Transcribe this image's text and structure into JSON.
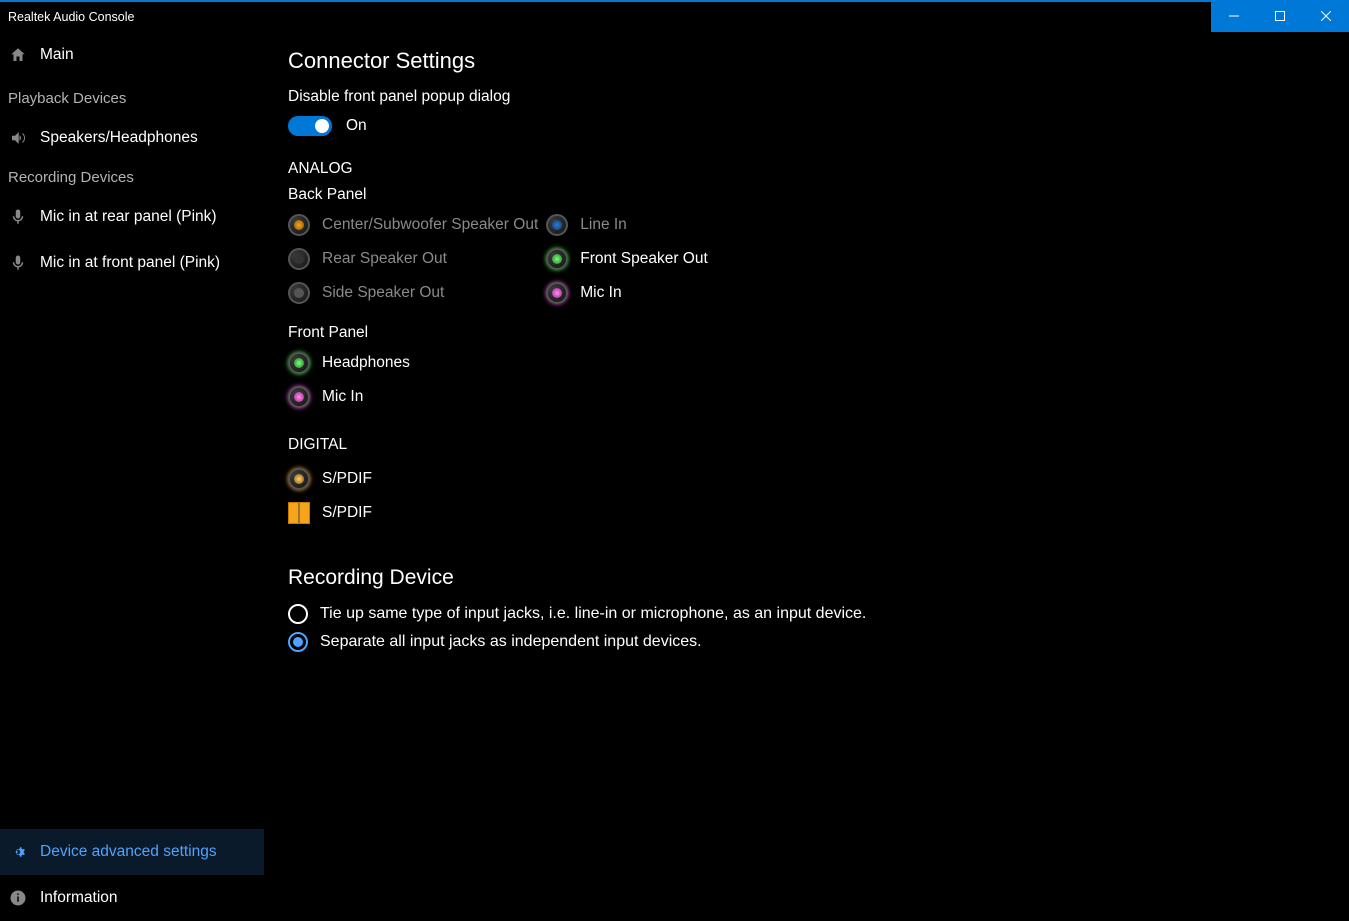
{
  "titlebar": {
    "title": "Realtek Audio Console"
  },
  "sidebar": {
    "main": "Main",
    "playback_group": "Playback Devices",
    "speakers": "Speakers/Headphones",
    "recording_group": "Recording Devices",
    "mic_rear": "Mic in at rear panel (Pink)",
    "mic_front": "Mic in at front panel (Pink)",
    "advanced": "Device advanced settings",
    "information": "Information"
  },
  "content": {
    "heading": "Connector Settings",
    "disable_popup_label": "Disable front panel popup dialog",
    "toggle_state": "On",
    "analog_head": "ANALOG",
    "back_panel": "Back Panel",
    "jacks_back_left": {
      "center_sub": "Center/Subwoofer Speaker Out",
      "rear": "Rear Speaker Out",
      "side": "Side Speaker Out"
    },
    "jacks_back_right": {
      "line_in": "Line In",
      "front_sp": "Front Speaker Out",
      "mic_in": "Mic In"
    },
    "front_panel": "Front Panel",
    "jacks_front": {
      "headphones": "Headphones",
      "mic_in": "Mic In"
    },
    "digital_head": "DIGITAL",
    "spdif1": "S/PDIF",
    "spdif2": "S/PDIF",
    "rec_head": "Recording Device",
    "opt_tie": "Tie up same type of input jacks, i.e. line-in or microphone, as an input device.",
    "opt_sep": "Separate all input jacks as independent input devices."
  },
  "colors": {
    "orange": "#f7a41d",
    "grey": "#6e6e6e",
    "blue": "#2b7bd9",
    "green": "#38e23b",
    "pink": "#e24fd9"
  }
}
